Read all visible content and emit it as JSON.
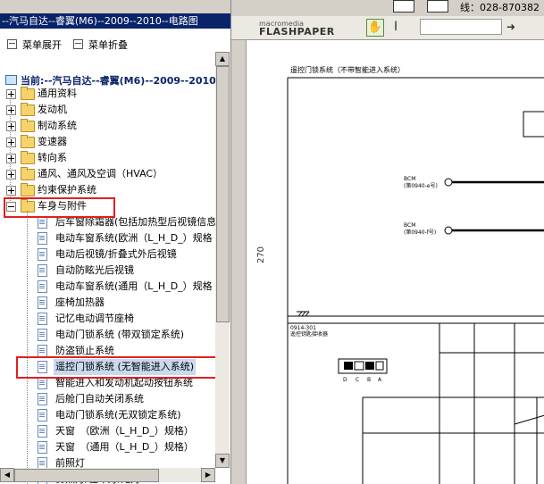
{
  "left_panel": {
    "title": "--汽马自达--睿翼(M6)--2009--2010--电路图",
    "menu": {
      "expand_label": "菜单展开",
      "collapse_label": "菜单折叠"
    },
    "current": "当前:--汽马自达--睿翼(M6)--2009--2010",
    "top_folders": [
      "通用资料",
      "发动机",
      "制动系统",
      "变速器",
      "转向系",
      "通风、通风及空调（HVAC）",
      "约束保护系统"
    ],
    "open_folder": "车身与附件",
    "children": [
      "后车窗除霜器(包括加热型后视镜信息",
      "电动车窗系统(欧洲（L_H_D_）规格",
      "电动后视镜/折叠式外后视镜",
      "自动防眩光后视镜",
      "电动车窗系统(通用（L_H_D_）规格",
      "座椅加热器",
      "记忆电动调节座椅",
      "电动门锁系统 (带双锁定系统)",
      "防盗锁止系统",
      "遥控门锁系统 (无智能进入系统)",
      "智能进入和发动机起动按钮系统",
      "后舱门自动关闭系统",
      "电动门锁系统(无双锁定系统)",
      "天窗　（欧洲（L_H_D_）规格）",
      "天窗　（通用（L_H_D_）规格）",
      "前照灯",
      "雾照灯/驻车灯/尾灯"
    ],
    "selected_child_index": 9
  },
  "right_panel": {
    "top_fragment": "线：028-870382",
    "viewer_logo_small": "macromedia",
    "viewer_logo": "FLASHPAPER",
    "page_number": "270",
    "diagram_title": "遥控门锁系统（不带智能进入系统）",
    "bcm1": "BCM",
    "bcm1_sub": "(第0940-e号)",
    "bcm2": "BCM",
    "bcm2_sub": "(第0940-f号)",
    "part_id": "0914-301",
    "part_name": "遥控钥匙接收器",
    "connector_letters": [
      "D",
      "C",
      "B",
      "A"
    ]
  },
  "colors": {
    "title_bar": "#0a246a",
    "highlight": "#e02020",
    "selection": "#c9d9ee"
  }
}
